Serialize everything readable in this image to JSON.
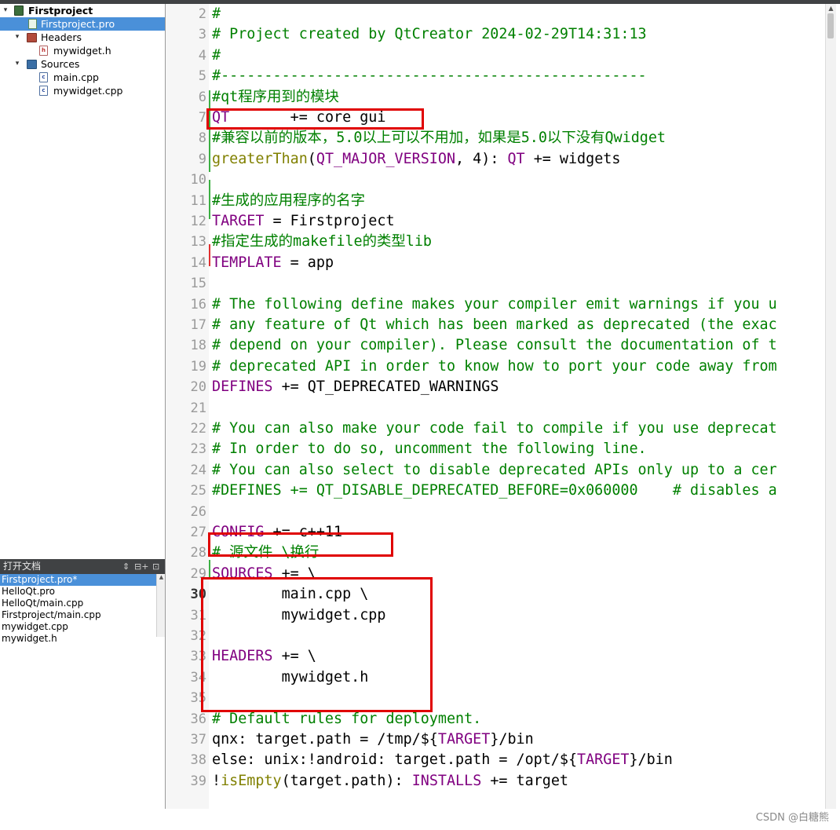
{
  "project_tree": {
    "items": [
      {
        "label": "Firstproject"
      },
      {
        "label": "Firstproject.pro"
      },
      {
        "label": "Headers"
      },
      {
        "label": "mywidget.h"
      },
      {
        "label": "Sources"
      },
      {
        "label": "main.cpp"
      },
      {
        "label": "mywidget.cpp"
      }
    ]
  },
  "open_documents": {
    "title": "打开文档",
    "controls": [
      "⇕",
      "⊟+",
      "⊡"
    ],
    "items": [
      "Firstproject.pro*",
      "HelloQt.pro",
      "HelloQt/main.cpp",
      "Firstproject/main.cpp",
      "mywidget.cpp",
      "mywidget.h"
    ],
    "selected_index": 0
  },
  "editor": {
    "file": "Firstproject.pro",
    "current_line": 30,
    "lines": [
      {
        "n": "2",
        "text": "#"
      },
      {
        "n": "3",
        "text": "# Project created by QtCreator 2024-02-29T14:31:13"
      },
      {
        "n": "4",
        "text": "#"
      },
      {
        "n": "5",
        "text": "#-------------------------------------------------"
      },
      {
        "n": "6",
        "text": "#qt程序用到的模块"
      },
      {
        "n": "7",
        "text": "QT       += core gui"
      },
      {
        "n": "8",
        "text": "#兼容以前的版本，5.0以上可以不用加，如果是5.0以下没有Qwidget"
      },
      {
        "n": "9",
        "text": "greaterThan(QT_MAJOR_VERSION, 4): QT += widgets"
      },
      {
        "n": "10",
        "text": ""
      },
      {
        "n": "11",
        "text": "#生成的应用程序的名字"
      },
      {
        "n": "12",
        "text": "TARGET = Firstproject"
      },
      {
        "n": "13",
        "text": "#指定生成的makefile的类型lib"
      },
      {
        "n": "14",
        "text": "TEMPLATE = app"
      },
      {
        "n": "15",
        "text": ""
      },
      {
        "n": "16",
        "text": "# The following define makes your compiler emit warnings if you u"
      },
      {
        "n": "17",
        "text": "# any feature of Qt which has been marked as deprecated (the exac"
      },
      {
        "n": "18",
        "text": "# depend on your compiler). Please consult the documentation of t"
      },
      {
        "n": "19",
        "text": "# deprecated API in order to know how to port your code away from"
      },
      {
        "n": "20",
        "text": "DEFINES += QT_DEPRECATED_WARNINGS"
      },
      {
        "n": "21",
        "text": ""
      },
      {
        "n": "22",
        "text": "# You can also make your code fail to compile if you use deprecat"
      },
      {
        "n": "23",
        "text": "# In order to do so, uncomment the following line."
      },
      {
        "n": "24",
        "text": "# You can also select to disable deprecated APIs only up to a cer"
      },
      {
        "n": "25",
        "text": "#DEFINES += QT_DISABLE_DEPRECATED_BEFORE=0x060000    # disables a"
      },
      {
        "n": "26",
        "text": ""
      },
      {
        "n": "27",
        "text": "CONFIG += c++11"
      },
      {
        "n": "28",
        "text": "# 源文件 \\换行"
      },
      {
        "n": "29",
        "text": "SOURCES += \\"
      },
      {
        "n": "30",
        "text": "        main.cpp \\"
      },
      {
        "n": "31",
        "text": "        mywidget.cpp"
      },
      {
        "n": "32",
        "text": ""
      },
      {
        "n": "33",
        "text": "HEADERS += \\"
      },
      {
        "n": "34",
        "text": "        mywidget.h"
      },
      {
        "n": "35",
        "text": ""
      },
      {
        "n": "36",
        "text": "# Default rules for deployment."
      },
      {
        "n": "37",
        "text": "qnx: target.path = /tmp/$${TARGET}/bin"
      },
      {
        "n": "38",
        "text": "else: unix:!android: target.path = /opt/$${TARGET}/bin"
      },
      {
        "n": "39",
        "text": "!isEmpty(target.path): INSTALLS += target"
      }
    ]
  },
  "watermark": "CSDN @白糖熊",
  "colors": {
    "comment": "#008000",
    "keyword": "#800080",
    "function": "#808000",
    "selection": "#4a90d9",
    "annotation_box": "#e00000"
  },
  "icons": [
    "project-icon",
    "pro-file-icon",
    "headers-folder-icon",
    "header-file-icon",
    "sources-folder-icon",
    "cpp-file-icon"
  ]
}
